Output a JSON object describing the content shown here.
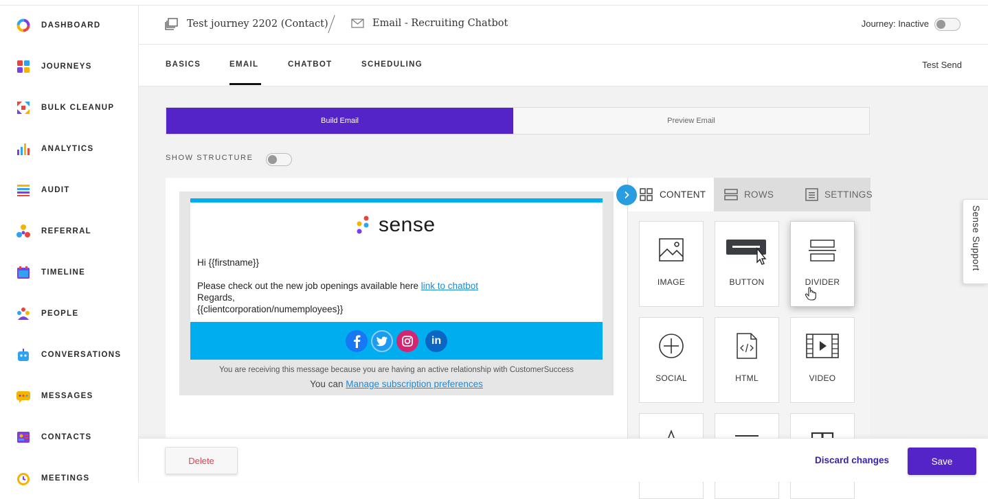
{
  "sidebar": {
    "items": [
      {
        "label": "DASHBOARD",
        "icon": "dashboard-ring-icon"
      },
      {
        "label": "JOURNEYS",
        "icon": "journeys-grid-icon"
      },
      {
        "label": "BULK CLEANUP",
        "icon": "bulk-cleanup-icon"
      },
      {
        "label": "ANALYTICS",
        "icon": "analytics-bars-icon"
      },
      {
        "label": "AUDIT",
        "icon": "audit-list-icon"
      },
      {
        "label": "REFERRAL",
        "icon": "referral-icon"
      },
      {
        "label": "TIMELINE",
        "icon": "timeline-icon"
      },
      {
        "label": "PEOPLE",
        "icon": "people-icon"
      },
      {
        "label": "CONVERSATIONS",
        "icon": "conversations-bot-icon"
      },
      {
        "label": "MESSAGES",
        "icon": "messages-icon"
      },
      {
        "label": "CONTACTS",
        "icon": "contacts-icon"
      },
      {
        "label": "MEETINGS",
        "icon": "meetings-clock-icon"
      }
    ]
  },
  "header": {
    "journey_name": "Test journey 2202 (Contact)",
    "email_name": "Email - Recruiting Chatbot",
    "journey_status": "Journey: Inactive"
  },
  "tabs": {
    "items": [
      "BASICS",
      "EMAIL",
      "CHATBOT",
      "SCHEDULING"
    ],
    "active": "EMAIL",
    "test_send": "Test Send"
  },
  "builder": {
    "build_label": "Build Email",
    "preview_label": "Preview Email",
    "show_structure": "SHOW STRUCTURE"
  },
  "email": {
    "logo_text": "sense",
    "greeting": "Hi {{firstname}}",
    "line1": "Please check out the new job openings available here ",
    "link_text": "link to chatbot",
    "regards": "Regards,",
    "signature": "{{clientcorporation/numemployees}}",
    "social": [
      "facebook",
      "twitter",
      "instagram",
      "linkedin"
    ],
    "footer_notice": "You are receiving this message because you are having an active relationship with CustomerSuccess",
    "footer_prefix": "You can ",
    "footer_link": "Manage subscription preferences"
  },
  "panel": {
    "tabs": [
      "CONTENT",
      "ROWS",
      "SETTINGS"
    ],
    "active_tab": "CONTENT",
    "tiles": [
      {
        "label": "IMAGE",
        "icon": "image-icon"
      },
      {
        "label": "BUTTON",
        "icon": "button-icon"
      },
      {
        "label": "DIVIDER",
        "icon": "divider-icon"
      },
      {
        "label": "SOCIAL",
        "icon": "social-plus-icon"
      },
      {
        "label": "HTML",
        "icon": "html-file-icon"
      },
      {
        "label": "VIDEO",
        "icon": "video-film-icon"
      }
    ]
  },
  "footer": {
    "delete": "Delete",
    "discard": "Discard changes",
    "save": "Save"
  },
  "support": "Sense Support",
  "colors": {
    "primary": "#5524c9",
    "email_accent": "#00aeef",
    "link": "#1a8ad6",
    "delete": "#e04050"
  }
}
